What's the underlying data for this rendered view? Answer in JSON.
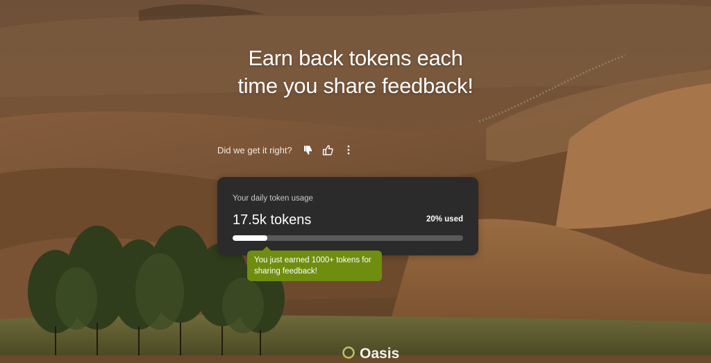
{
  "headline": {
    "line1": "Earn back tokens each",
    "line2": "time you share feedback!"
  },
  "feedback": {
    "question": "Did we get it right?",
    "thumbs_down_icon": "thumbs-down-icon",
    "thumbs_up_icon": "thumbs-up-icon",
    "more_icon": "more-vertical-icon"
  },
  "usage_card": {
    "label": "Your daily token usage",
    "value": "17.5k tokens",
    "percent_label": "20% used",
    "used_fraction": 0.15,
    "accent": "#ffffff",
    "track": "#5a5a5a"
  },
  "tooltip": {
    "text_line1": "You just earned 1000+ tokens for",
    "text_line2": "sharing feedback!",
    "color": "#6f8e10"
  },
  "brand": {
    "name": "Oasis",
    "logo_icon": "oasis-logo-icon"
  }
}
